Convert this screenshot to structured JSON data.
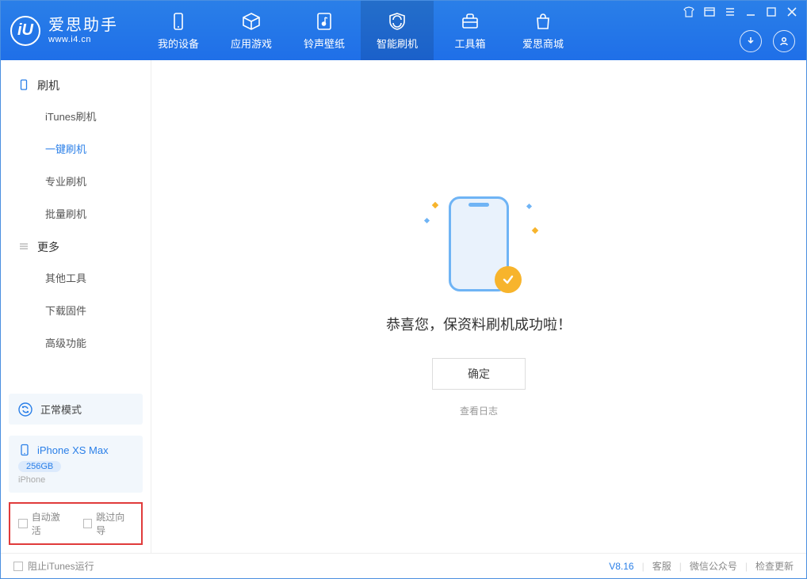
{
  "app": {
    "logo_glyph": "iU",
    "logo_main": "爱思助手",
    "logo_sub": "www.i4.cn"
  },
  "nav": [
    {
      "label": "我的设备",
      "icon": "device"
    },
    {
      "label": "应用游戏",
      "icon": "cube"
    },
    {
      "label": "铃声壁纸",
      "icon": "music"
    },
    {
      "label": "智能刷机",
      "icon": "shield",
      "active": true
    },
    {
      "label": "工具箱",
      "icon": "toolbox"
    },
    {
      "label": "爱思商城",
      "icon": "shop"
    }
  ],
  "sidebar": {
    "groups": [
      {
        "title": "刷机",
        "items": [
          "iTunes刷机",
          "一键刷机",
          "专业刷机",
          "批量刷机"
        ],
        "activeIndex": 1
      },
      {
        "title": "更多",
        "items": [
          "其他工具",
          "下载固件",
          "高级功能"
        ],
        "activeIndex": -1
      }
    ]
  },
  "device": {
    "mode_label": "正常模式",
    "name": "iPhone XS Max",
    "capacity": "256GB",
    "type": "iPhone"
  },
  "options": {
    "auto_activate": "自动激活",
    "skip_guide": "跳过向导"
  },
  "main": {
    "success_msg": "恭喜您，保资料刷机成功啦！",
    "ok_label": "确定",
    "log_link": "查看日志"
  },
  "status": {
    "block_itunes": "阻止iTunes运行",
    "version": "V8.16",
    "links": [
      "客服",
      "微信公众号",
      "检查更新"
    ]
  }
}
